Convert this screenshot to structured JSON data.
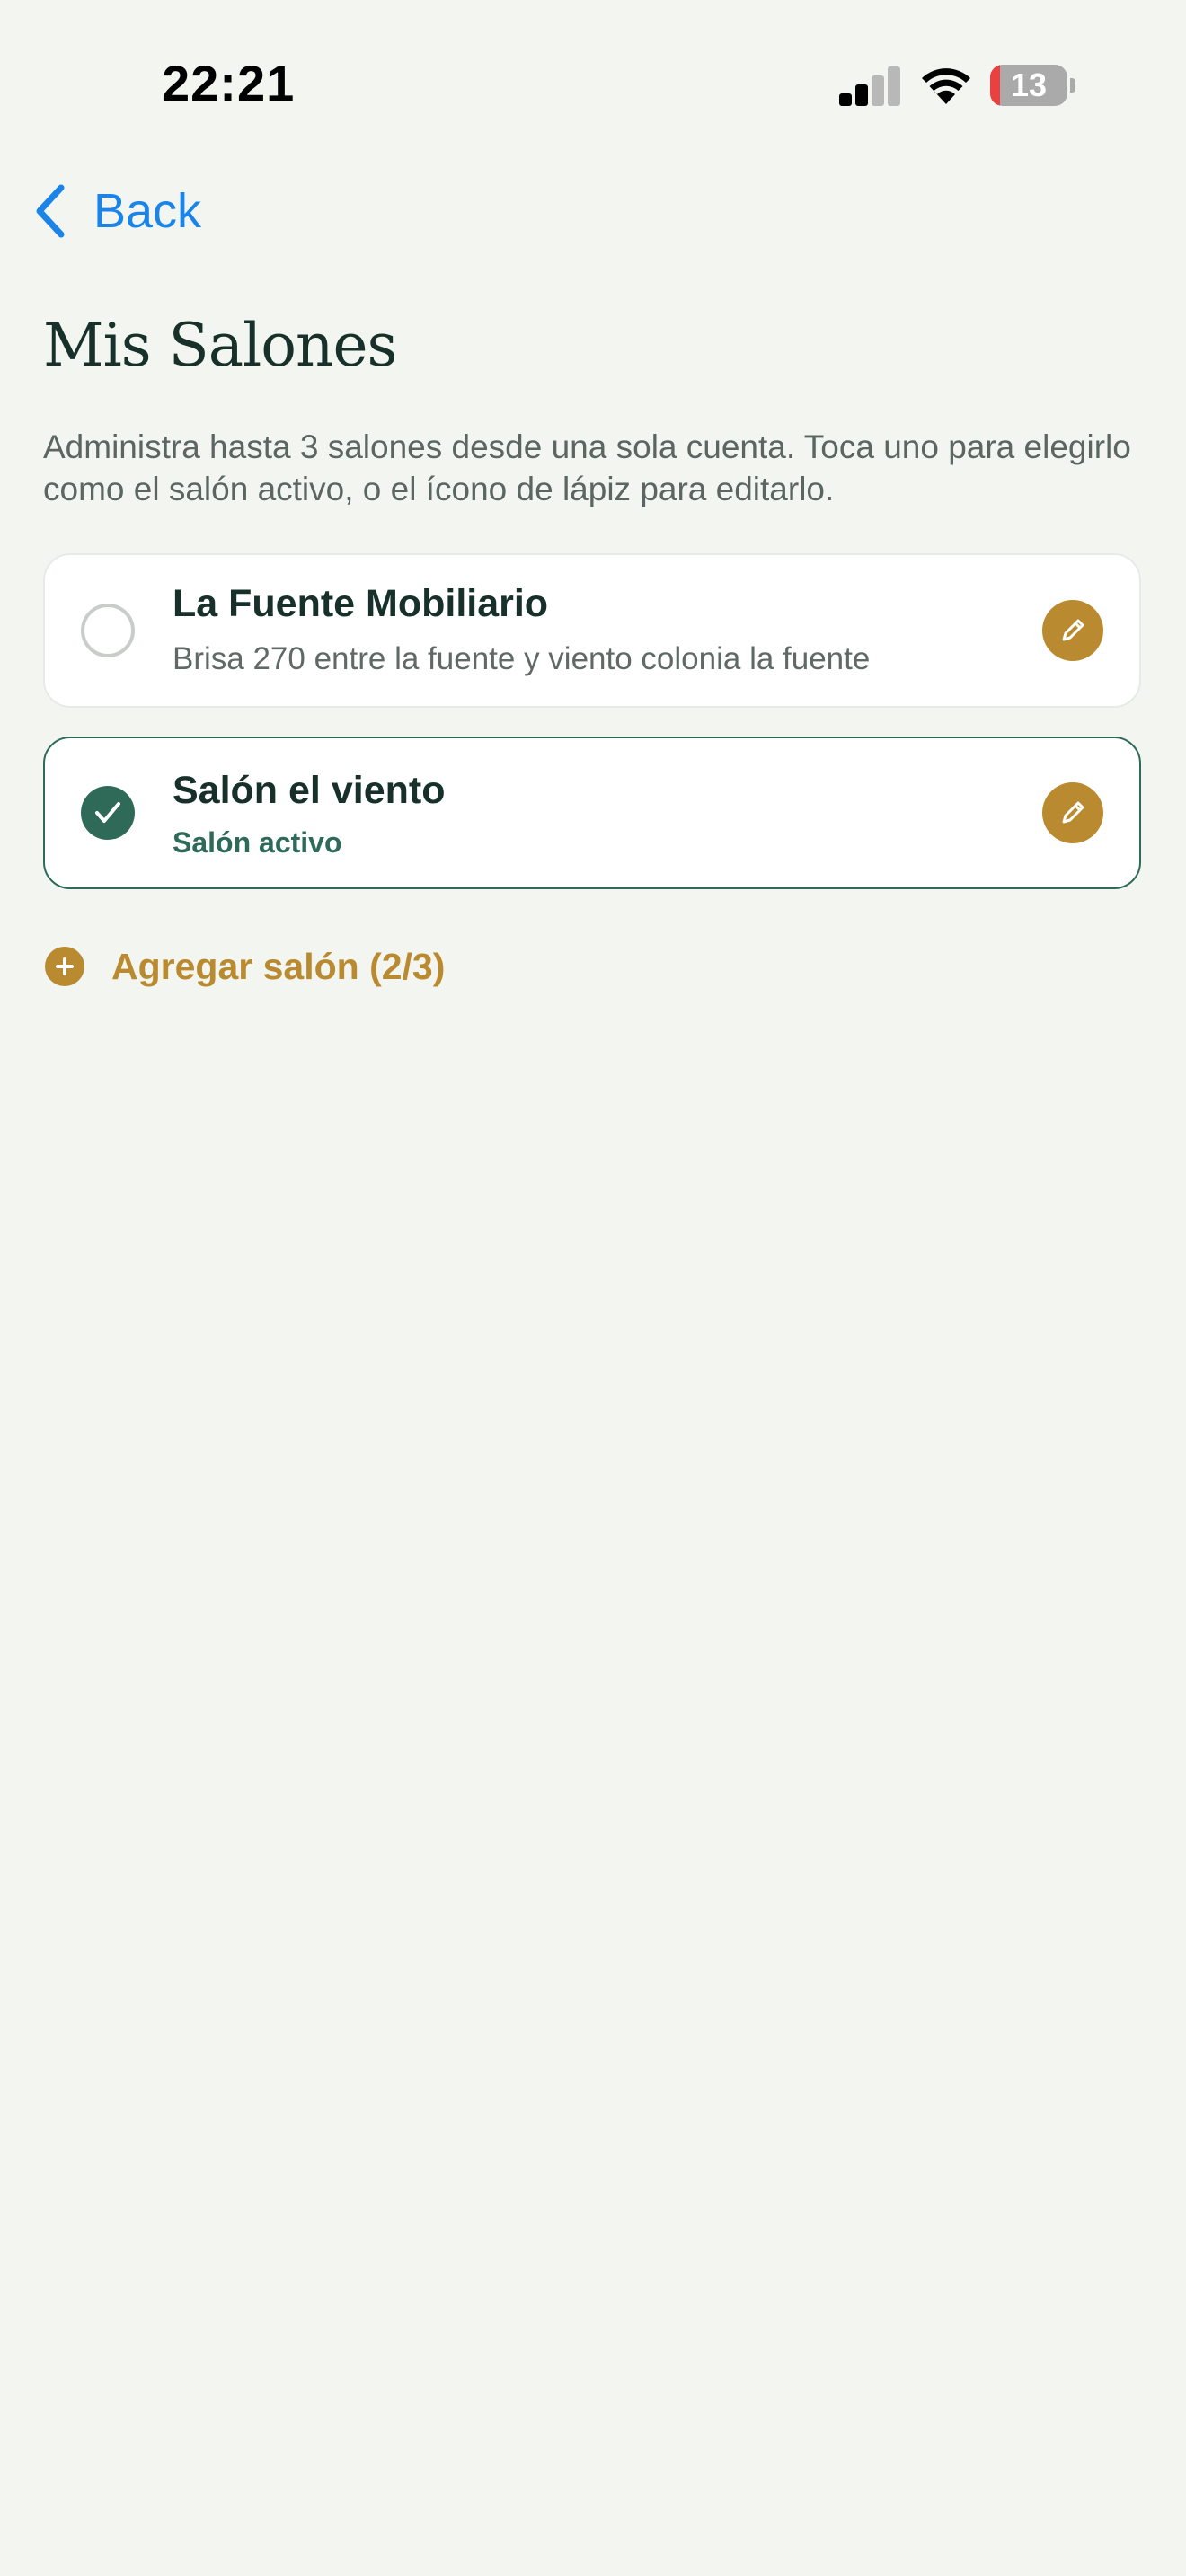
{
  "status_bar": {
    "time": "22:21",
    "battery_percent": "13",
    "battery_level": 0.13,
    "signal_bars_active": 2,
    "signal_bars_total": 4,
    "icons": [
      "signal-icon",
      "wifi-icon",
      "battery-icon"
    ]
  },
  "nav": {
    "back_label": "Back",
    "back_icon": "chevron-left-icon"
  },
  "header": {
    "title": "Mis Salones",
    "description": "Administra hasta 3 salones desde una sola cuenta. Toca uno para elegirlo como el salón activo, o el ícono de lápiz para editarlo."
  },
  "salons": [
    {
      "name": "La Fuente Mobiliario",
      "subtitle": "Brisa 270 entre la fuente y viento colonia la fuente",
      "active": false,
      "edit_icon": "pencil-icon"
    },
    {
      "name": "Salón el viento",
      "subtitle": "Salón activo",
      "active": true,
      "edit_icon": "pencil-icon"
    }
  ],
  "add_salon": {
    "label": "Agregar salón (2/3)",
    "icon": "plus-circle-icon"
  },
  "colors": {
    "background": "#f3f5f1",
    "accent_gold": "#b98a30",
    "active_green": "#2f6a58",
    "link_blue": "#1a84e8",
    "text_dark": "#17302a"
  }
}
